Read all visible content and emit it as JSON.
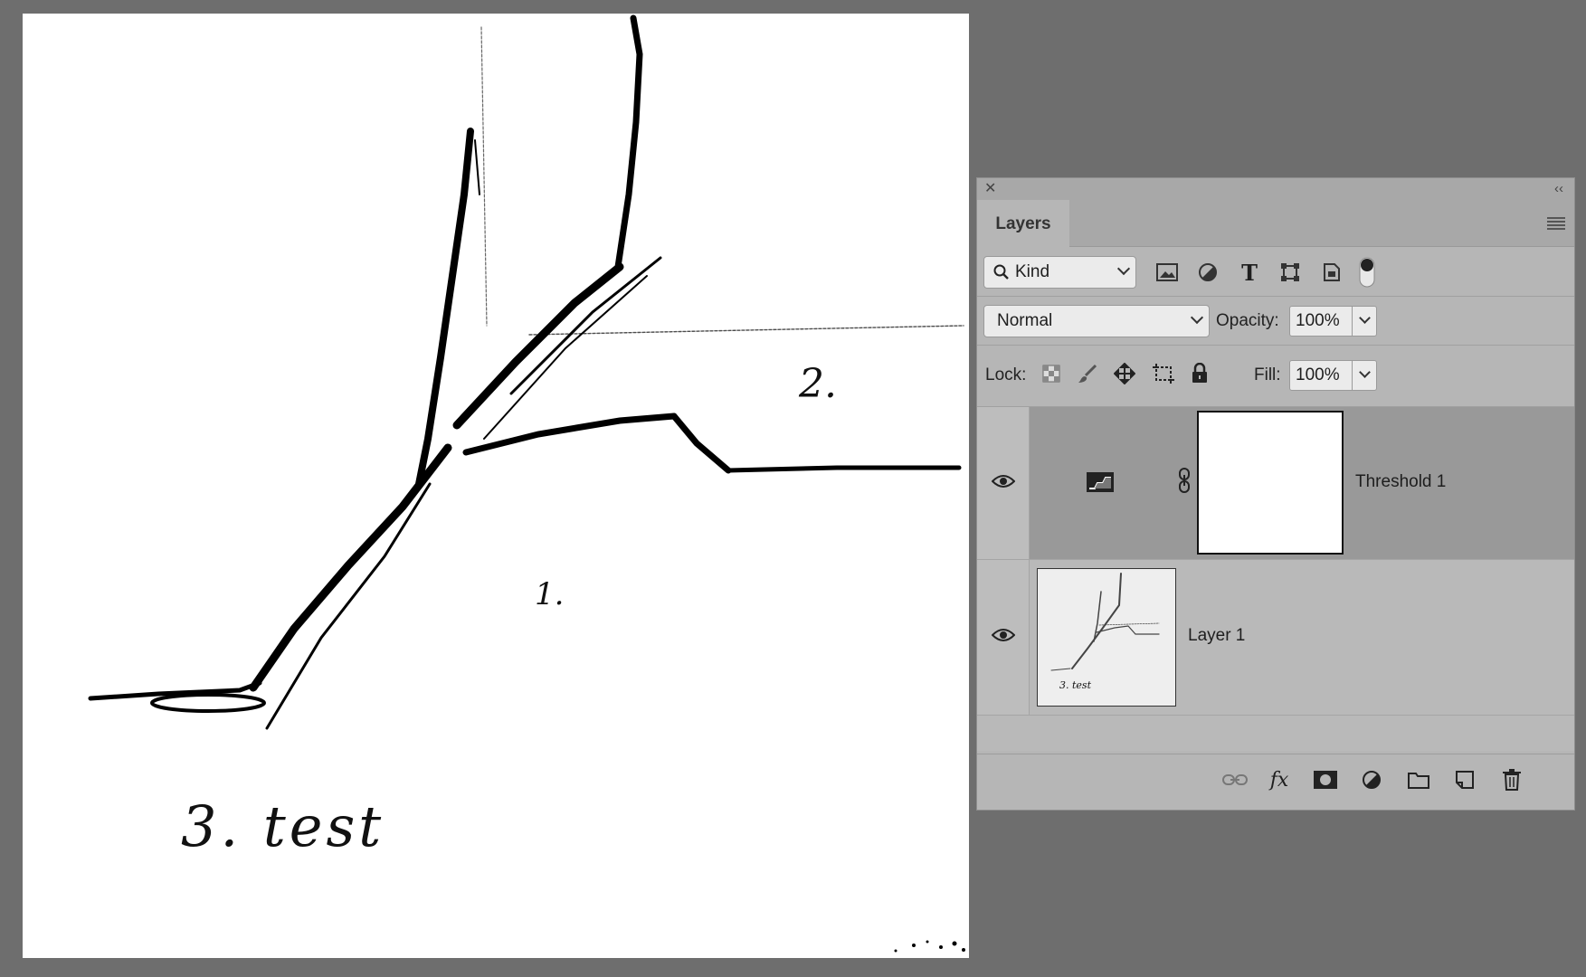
{
  "panel": {
    "tab_label": "Layers",
    "close_glyph": "✕",
    "collapse_glyph": "‹‹"
  },
  "filter": {
    "kind_label": "Kind",
    "icons": [
      "pixel-filter-icon",
      "adjustment-filter-icon",
      "type-filter-icon",
      "shape-filter-icon",
      "smart-object-filter-icon",
      "filter-toggle-icon"
    ],
    "type_glyph": "T"
  },
  "blend": {
    "mode": "Normal",
    "opacity_label": "Opacity:",
    "opacity_value": "100%"
  },
  "lock": {
    "label": "Lock:",
    "fill_label": "Fill:",
    "fill_value": "100%"
  },
  "layers": [
    {
      "name": "Threshold 1",
      "type": "adjustment",
      "visible": true,
      "selected": true
    },
    {
      "name": "Layer 1",
      "type": "pixel",
      "visible": true,
      "selected": false
    }
  ],
  "canvas": {
    "label_2": "2.",
    "label_1": "1.",
    "label_3": "3. test",
    "thumb_label": "3. test"
  },
  "footer_icons": [
    "link-layers-icon",
    "fx-icon",
    "add-mask-icon",
    "new-adjustment-icon",
    "new-group-icon",
    "new-layer-icon",
    "delete-layer-icon"
  ],
  "footer": {
    "fx_label": "fx"
  },
  "colors": {
    "workspace": "#6e6e6e",
    "panel": "#b6b6b6",
    "selected_row": "#999999"
  }
}
